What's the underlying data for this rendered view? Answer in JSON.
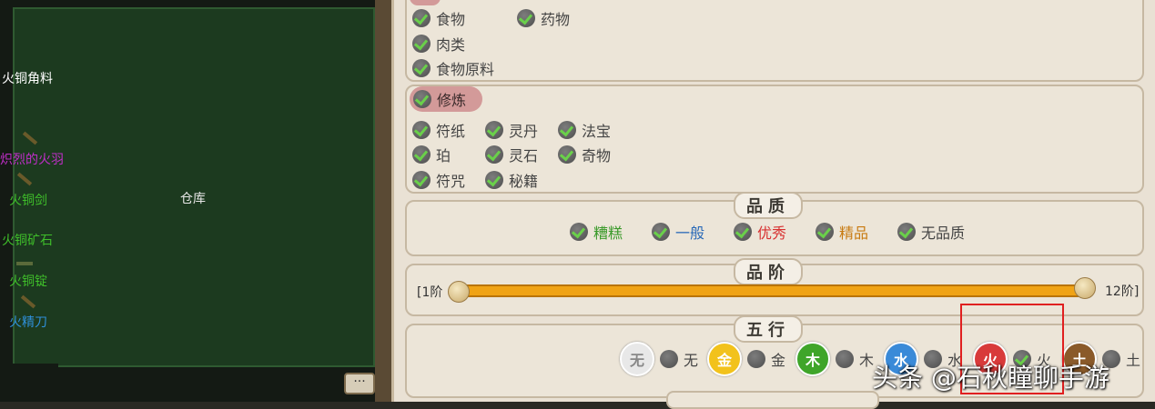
{
  "left": {
    "items": [
      {
        "label": "火铜角料",
        "color": "#ffffff"
      },
      {
        "label": "炽烈的火羽",
        "color": "#c02ec8"
      },
      {
        "label": "火铜剑",
        "color": "#3fbf2a"
      },
      {
        "label": "火铜矿石",
        "color": "#3fbf2a"
      },
      {
        "label": "火铜锭",
        "color": "#3fbf2a"
      },
      {
        "label": "火精刀",
        "color": "#2f8fd8"
      }
    ],
    "warehouse_label": "仓库",
    "msg_button": "···"
  },
  "categories": {
    "food_group": {
      "items": [
        "食物",
        "药物",
        "肉类",
        "食物原料"
      ]
    },
    "cultivation_group": {
      "title": "修炼",
      "items": [
        "符纸",
        "灵丹",
        "法宝",
        "珀",
        "灵石",
        "奇物",
        "符咒",
        "秘籍"
      ]
    }
  },
  "quality": {
    "title": "品质",
    "options": [
      {
        "label": "糟糕",
        "color": "#3a9a2a"
      },
      {
        "label": "一般",
        "color": "#2a6ab8"
      },
      {
        "label": "优秀",
        "color": "#d83030"
      },
      {
        "label": "精品",
        "color": "#c87a10"
      },
      {
        "label": "无品质",
        "color": "#444444"
      }
    ]
  },
  "rank": {
    "title": "品阶",
    "min_label": "[1阶",
    "max_label": "12阶]",
    "min": 1,
    "max": 12
  },
  "five_elements": {
    "title": "五行",
    "elements": [
      {
        "badge": "无",
        "label": "无",
        "color": "#e8e8e8",
        "text_color": "#888888",
        "checked": false
      },
      {
        "badge": "金",
        "label": "金",
        "color": "#f2c21c",
        "text_color": "#ffffff",
        "checked": false
      },
      {
        "badge": "木",
        "label": "木",
        "color": "#3fa52a",
        "text_color": "#ffffff",
        "checked": false
      },
      {
        "badge": "水",
        "label": "水",
        "color": "#3a8ad8",
        "text_color": "#ffffff",
        "checked": false
      },
      {
        "badge": "火",
        "label": "火",
        "color": "#d83a3a",
        "text_color": "#ffffff",
        "checked": true
      },
      {
        "badge": "土",
        "label": "土",
        "color": "#8a5a2a",
        "text_color": "#ffffff",
        "checked": false
      }
    ]
  },
  "watermark": "头条 @石秋瞳聊手游"
}
